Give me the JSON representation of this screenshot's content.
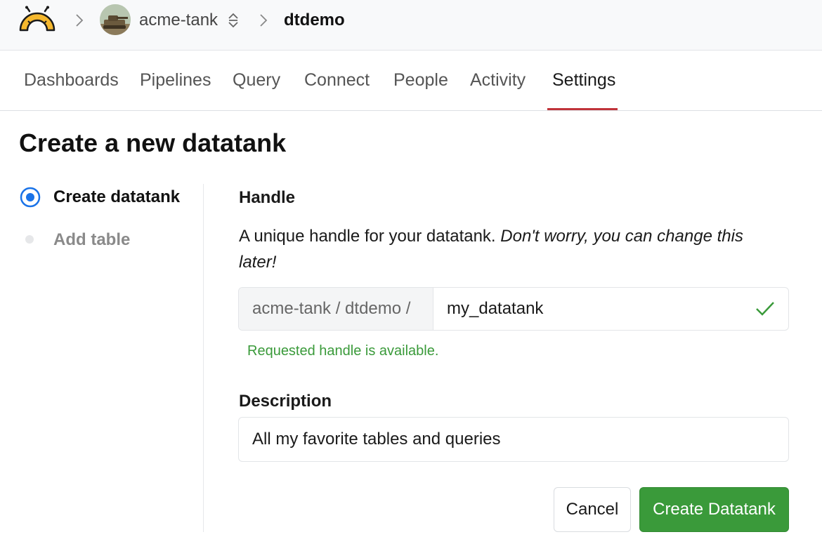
{
  "breadcrumb": {
    "org": "acme-tank",
    "project": "dtdemo"
  },
  "tabs": [
    {
      "label": "Dashboards"
    },
    {
      "label": "Pipelines"
    },
    {
      "label": "Query"
    },
    {
      "label": "Connect"
    },
    {
      "label": "People"
    },
    {
      "label": "Activity"
    },
    {
      "label": "Settings",
      "active": true
    }
  ],
  "page": {
    "title": "Create a new datatank"
  },
  "steps": [
    {
      "label": "Create datatank",
      "state": "current"
    },
    {
      "label": "Add table",
      "state": "pending"
    }
  ],
  "form": {
    "handle": {
      "label": "Handle",
      "help_plain": "A unique handle for your datatank. ",
      "help_italic": "Don't worry, you can change this later!",
      "prefix": "acme-tank / dtdemo /",
      "value": "my_datatank",
      "status": "Requested handle is available.",
      "status_icon": "check-icon"
    },
    "description": {
      "label": "Description",
      "value": "All my favorite tables and queries"
    },
    "cancel_label": "Cancel",
    "submit_label": "Create Datatank"
  },
  "colors": {
    "accent_blue": "#1a73e8",
    "success_green": "#3a9a3a",
    "active_tab_underline": "#c0333a",
    "logo_yellow": "#f5b82e"
  }
}
